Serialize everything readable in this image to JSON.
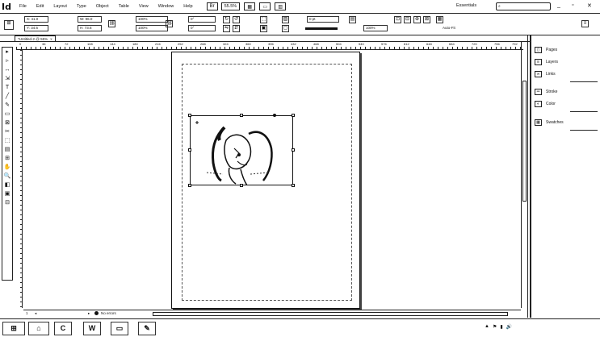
{
  "app": {
    "logo": "Id"
  },
  "menu": [
    "File",
    "Edit",
    "Layout",
    "Type",
    "Object",
    "Table",
    "View",
    "Window",
    "Help"
  ],
  "menubar": {
    "zoom": "55.5%",
    "workspace": "Essentials",
    "search_placeholder": "",
    "minimize": "_",
    "restore": "▫",
    "close": "✕"
  },
  "control": {
    "x": "X: 41.0",
    "y": "Y: 34.6",
    "w": "W: 96.0",
    "h": "H: 73.6",
    "scale_x": "100%",
    "scale_y": "100%",
    "angle": "0°",
    "shear": "0°",
    "stroke_weight": "0 pt",
    "opacity": "100%",
    "autofit": "Auto-Fit"
  },
  "document_tab": {
    "title": "*Untitled-2 @ 55%",
    "close": "×"
  },
  "ruler": [
    "0",
    "36",
    "72",
    "108",
    "144",
    "180",
    "216",
    "252",
    "288",
    "324",
    "360",
    "396",
    "432",
    "468",
    "504",
    "540",
    "576",
    "612",
    "648",
    "684",
    "720",
    "756",
    "792"
  ],
  "tools": [
    "▸",
    "▹",
    "↔",
    "⇲",
    "T",
    "╱",
    "✎",
    "▭",
    "⊠",
    "✂",
    "⬚",
    "▤",
    "⊞",
    "✋",
    "🔍",
    "◧",
    "▣",
    "⊟"
  ],
  "panel": {
    "items": [
      "Pages",
      "Layers",
      "Links",
      "Stroke",
      "Color",
      "Swatches"
    ]
  },
  "status": {
    "page": "1",
    "preflight": "No errors"
  },
  "taskbar": {
    "buttons": [
      "e",
      "⌂",
      "C",
      "W",
      "▭",
      "✎"
    ],
    "tray": [
      "▲",
      "⚑",
      "▮",
      "🔊"
    ],
    "time": "",
    "date": ""
  }
}
